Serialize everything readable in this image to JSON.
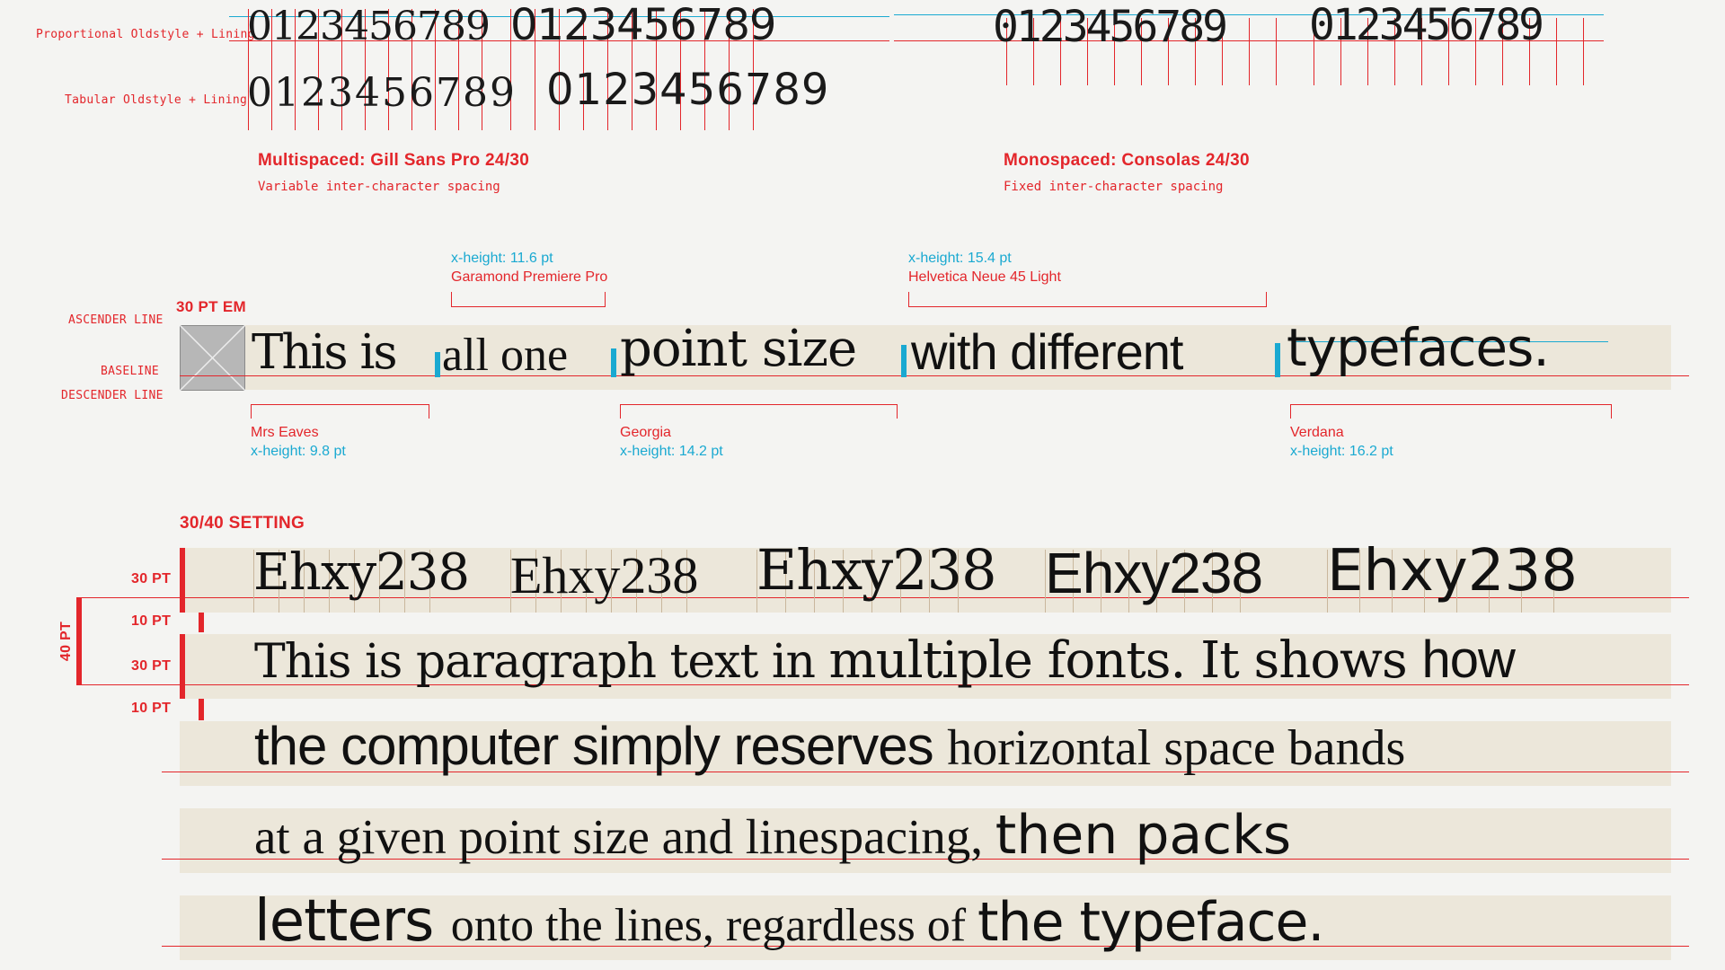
{
  "numerals": {
    "row1_label": "Proportional Oldstyle + Lining",
    "row2_label": "Tabular Oldstyle + Lining",
    "digits": "0123456789",
    "left_title": "Multispaced: Gill Sans Pro 24/30",
    "left_note": "Variable inter-character spacing",
    "right_title": "Monospaced: Consolas 24/30",
    "right_note": "Fixed inter-character spacing"
  },
  "point_size": {
    "em_label": "30 PT EM",
    "ascender_label": "ASCENDER LINE",
    "baseline_label": "BASELINE",
    "descender_label": "DESCENDER LINE",
    "segments": [
      "This is",
      "all one",
      "point size",
      "with different",
      "typefaces."
    ],
    "annotations": {
      "garamond_x": "x-height: 11.6 pt",
      "garamond_name": "Garamond Premiere Pro",
      "helvetica_x": "x-height: 15.4 pt",
      "helvetica_name": "Helvetica Neue 45 Light",
      "mrs_name": "Mrs Eaves",
      "mrs_x": "x-height: 9.8 pt",
      "georgia_name": "Georgia",
      "georgia_x": "x-height: 14.2 pt",
      "verdana_name": "Verdana",
      "verdana_x": "x-height: 16.2 pt"
    }
  },
  "setting": {
    "title": "30/40 SETTING",
    "pt30a": "30 PT",
    "pt10a": "10 PT",
    "pt30b": "30 PT",
    "pt10b": "10 PT",
    "pt40": "40 PT",
    "sample": "Ehxy238",
    "lines": [
      [
        "This is paragraph text in ",
        "multiple fonts. It shows ",
        "how"
      ],
      [
        "the computer simply reserves ",
        "horizontal space bands"
      ],
      [
        "at a given point size and linespacing, ",
        "then packs"
      ],
      [
        "letters ",
        "onto the lines, regardless of ",
        "the typeface."
      ]
    ]
  },
  "colors": {
    "accent_red": "#e3262b",
    "accent_cyan": "#1aa9d1",
    "band": "#ece7da",
    "background": "#f4f4f2"
  }
}
